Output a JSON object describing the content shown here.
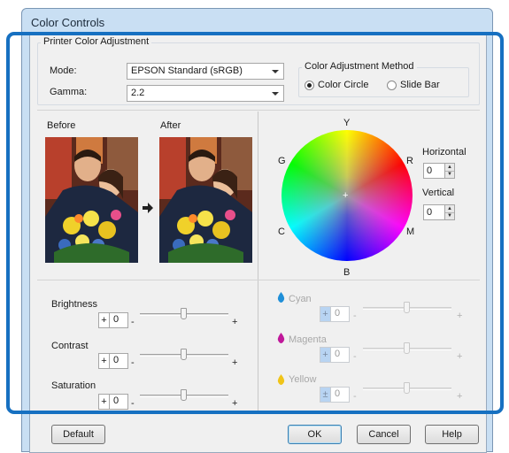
{
  "window": {
    "title": "Color Controls"
  },
  "printer_adjust": {
    "legend": "Printer Color Adjustment",
    "mode_label": "Mode:",
    "mode_value": "EPSON Standard (sRGB)",
    "gamma_label": "Gamma:",
    "gamma_value": "2.2",
    "method_legend": "Color Adjustment Method",
    "radio_color_circle": "Color Circle",
    "radio_slide_bar": "Slide Bar",
    "selected_method": "Color Circle"
  },
  "preview": {
    "before_label": "Before",
    "after_label": "After"
  },
  "color_circle": {
    "labels": {
      "y": "Y",
      "r": "R",
      "m": "M",
      "b": "B",
      "c": "C",
      "g": "G"
    },
    "horizontal_label": "Horizontal",
    "horizontal_value": "0",
    "vertical_label": "Vertical",
    "vertical_value": "0"
  },
  "adjustments": {
    "brightness": {
      "label": "Brightness",
      "sign": "+",
      "value": "0",
      "minus": "-",
      "plus": "+"
    },
    "contrast": {
      "label": "Contrast",
      "sign": "+",
      "value": "0",
      "minus": "-",
      "plus": "+"
    },
    "saturation": {
      "label": "Saturation",
      "sign": "+",
      "value": "0",
      "minus": "-",
      "plus": "+"
    }
  },
  "channels": {
    "cyan": {
      "label": "Cyan",
      "sign": "+",
      "value": "0",
      "minus": "-",
      "plus": "+",
      "color": "#1f8fd8"
    },
    "magenta": {
      "label": "Magenta",
      "sign": "+",
      "value": "0",
      "minus": "-",
      "plus": "+",
      "color": "#c0189a"
    },
    "yellow": {
      "label": "Yellow",
      "sign": "±",
      "value": "0",
      "minus": "-",
      "plus": "+",
      "color": "#f0c419"
    }
  },
  "buttons": {
    "default": "Default",
    "ok": "OK",
    "cancel": "Cancel",
    "help": "Help"
  },
  "icons": {
    "arrow": "right-arrow-icon",
    "spin": "spinner-arrows-icon",
    "drop": "ink-drop-icon"
  },
  "colors": {
    "highlight": "#1670c1",
    "titlebar": "#c9dff3",
    "dialog": "#f0f0f0"
  }
}
